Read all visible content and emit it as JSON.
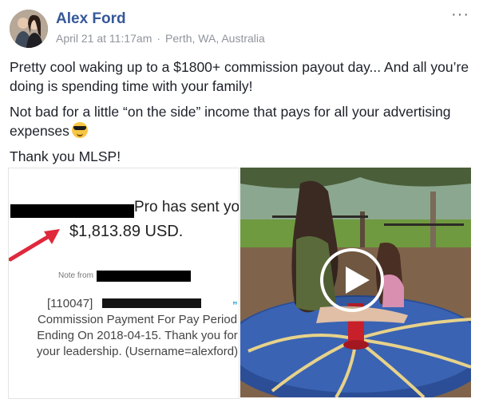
{
  "post": {
    "author": "Alex Ford",
    "date": "April 21 at 11:17am",
    "separator": "·",
    "location": "Perth, WA, Australia",
    "more_options": "···",
    "paragraphs": [
      "Pretty cool waking up to a $1800+ commission payout day... And all you’re doing is spending time with your family!",
      "Not bad for a little “on the side” income that pays for all your advertising expenses",
      "Thank you MLSP!"
    ],
    "emoji": "smiling-face-with-sunglasses"
  },
  "receipt": {
    "sent_text": "Pro has sent you",
    "amount": "$1,813.89 USD.",
    "note_from_label": "Note from",
    "memo_id": "[110047]",
    "memo_lines": [
      "Commission Payment For Pay Period",
      "Ending On 2018-04-15. Thank you for",
      "your leadership. (Username=alexford)"
    ],
    "arrow_color": "#e0283c"
  },
  "video": {
    "icon": "play-icon"
  },
  "colors": {
    "link": "#365899",
    "meta": "#90949c",
    "text": "#1d2129"
  }
}
